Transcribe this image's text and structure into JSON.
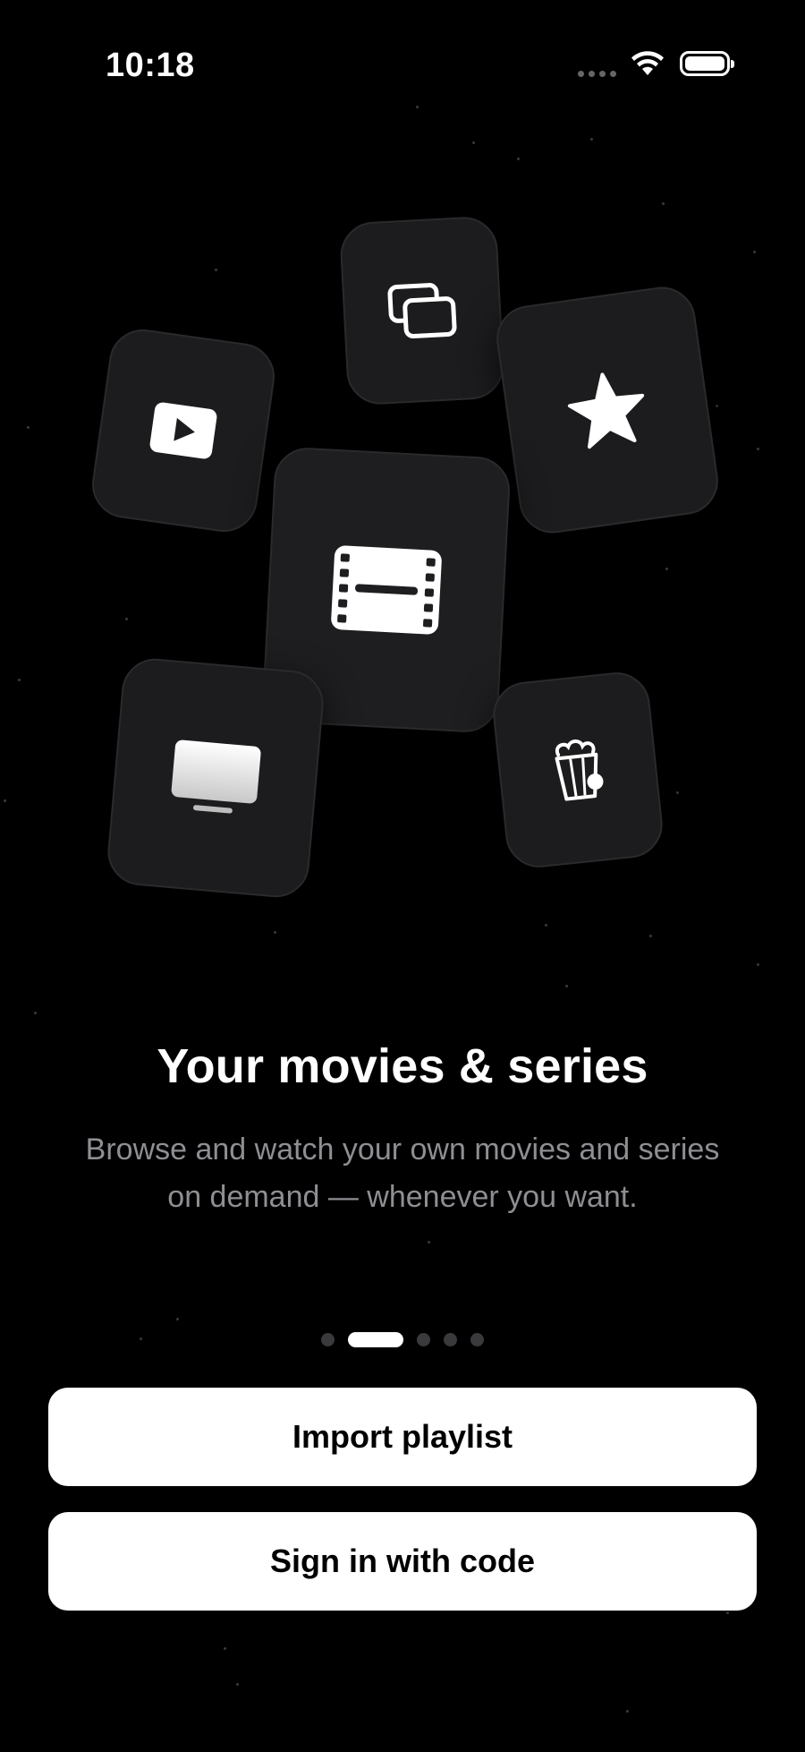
{
  "status_bar": {
    "time": "10:18"
  },
  "icons": {
    "stack": "stacked-windows-icon",
    "play": "play-button-icon",
    "star": "star-icon",
    "film": "film-strip-icon",
    "tv": "tv-icon",
    "popcorn": "popcorn-icon"
  },
  "onboarding": {
    "title": "Your movies & series",
    "subtitle_line1": "Browse and watch your own movies and series",
    "subtitle_line2": "on demand — whenever you want."
  },
  "pager": {
    "page_count": 5,
    "active_index": 1
  },
  "actions": {
    "import_label": "Import playlist",
    "code_label": "Sign in with code"
  },
  "colors": {
    "background": "#000000",
    "tile": "#1c1c1e",
    "button": "#ffffff",
    "subtitle": "#8e8e93"
  }
}
